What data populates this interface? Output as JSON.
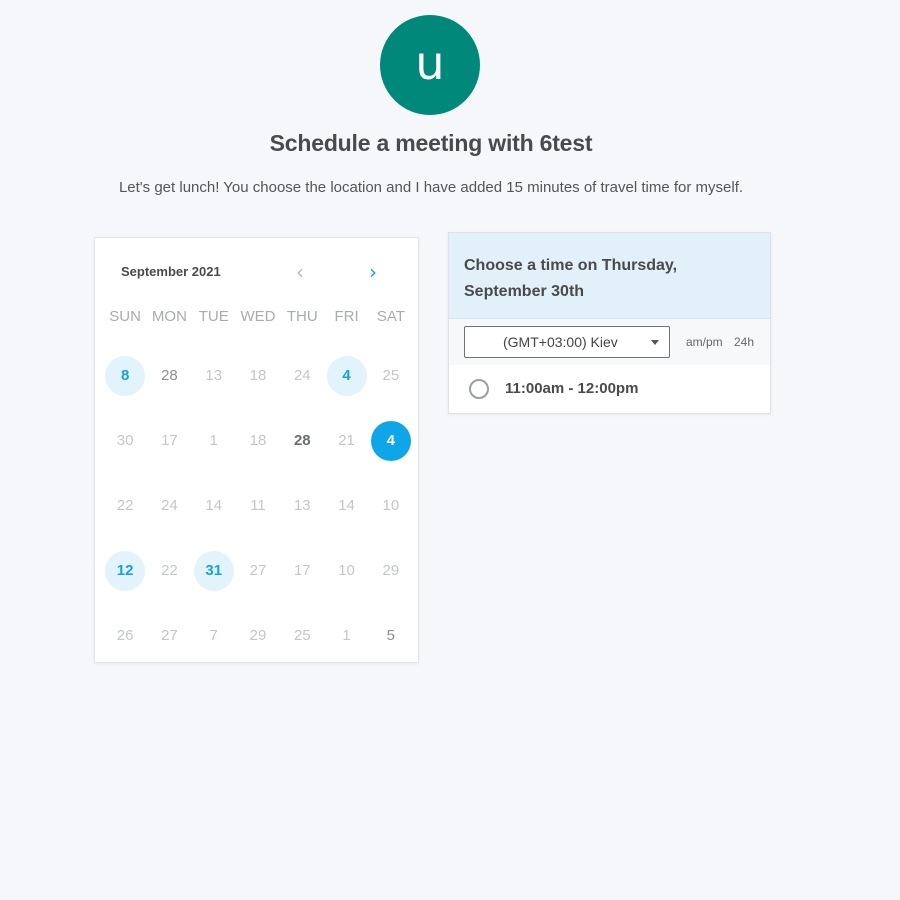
{
  "header": {
    "avatar_letter": "u",
    "title": "Schedule a meeting with 6test",
    "description": "Let's get lunch! You choose the location and I have added 15 minutes of travel time for myself."
  },
  "calendar": {
    "month_label": "September 2021",
    "prev_icon": "chevron-left-icon",
    "next_icon": "chevron-right-icon",
    "weekdays": [
      "SUN",
      "MON",
      "TUE",
      "WED",
      "THU",
      "FRI",
      "SAT"
    ],
    "weeks": [
      [
        {
          "label": "8",
          "state": "available"
        },
        {
          "label": "28",
          "state": "dark"
        },
        {
          "label": "13",
          "state": "muted"
        },
        {
          "label": "18",
          "state": "muted"
        },
        {
          "label": "24",
          "state": "muted"
        },
        {
          "label": "4",
          "state": "available"
        },
        {
          "label": "25",
          "state": "muted"
        }
      ],
      [
        {
          "label": "30",
          "state": "muted"
        },
        {
          "label": "17",
          "state": "muted"
        },
        {
          "label": "1",
          "state": "muted"
        },
        {
          "label": "18",
          "state": "muted"
        },
        {
          "label": "28",
          "state": "bold"
        },
        {
          "label": "21",
          "state": "muted"
        },
        {
          "label": "4",
          "state": "selected"
        }
      ],
      [
        {
          "label": "22",
          "state": "muted"
        },
        {
          "label": "24",
          "state": "muted"
        },
        {
          "label": "14",
          "state": "muted"
        },
        {
          "label": "11",
          "state": "muted"
        },
        {
          "label": "13",
          "state": "muted"
        },
        {
          "label": "14",
          "state": "muted"
        },
        {
          "label": "10",
          "state": "muted"
        }
      ],
      [
        {
          "label": "12",
          "state": "available"
        },
        {
          "label": "22",
          "state": "muted"
        },
        {
          "label": "31",
          "state": "available"
        },
        {
          "label": "27",
          "state": "muted"
        },
        {
          "label": "17",
          "state": "muted"
        },
        {
          "label": "10",
          "state": "muted"
        },
        {
          "label": "29",
          "state": "muted"
        }
      ],
      [
        {
          "label": "26",
          "state": "muted"
        },
        {
          "label": "27",
          "state": "muted"
        },
        {
          "label": "7",
          "state": "muted"
        },
        {
          "label": "29",
          "state": "muted"
        },
        {
          "label": "25",
          "state": "muted"
        },
        {
          "label": "1",
          "state": "muted"
        },
        {
          "label": "5",
          "state": "dark"
        }
      ]
    ]
  },
  "time_panel": {
    "title": "Choose a time on Thursday, September 30th",
    "timezone_value": "(GMT+03:00) Kiev",
    "format_ampm": "am/pm",
    "format_24h": "24h",
    "slots": [
      {
        "label": "11:00am - 12:00pm",
        "selected": false
      }
    ]
  },
  "colors": {
    "background": "#f5f7fb",
    "avatar": "#00897b",
    "accent": "#0ea5e9",
    "available_bg": "#e3f3fc",
    "panel_header_bg": "#e2f1f9"
  }
}
